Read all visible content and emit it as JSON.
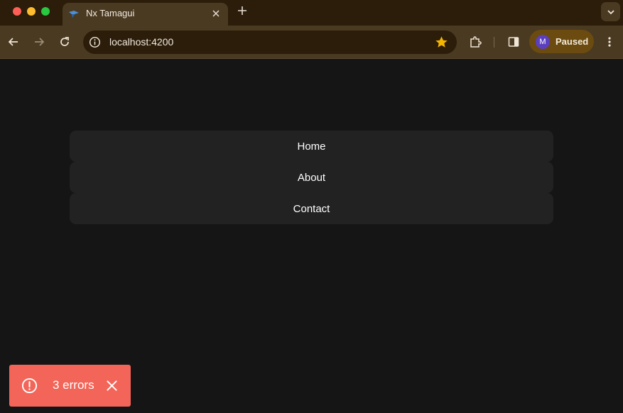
{
  "browser": {
    "tab": {
      "title": "Nx Tamagui"
    },
    "address": {
      "url": "localhost:4200"
    },
    "profile": {
      "initial": "M",
      "status": "Paused"
    }
  },
  "nav": {
    "items": [
      {
        "label": "Home"
      },
      {
        "label": "About"
      },
      {
        "label": "Contact"
      }
    ]
  },
  "toast": {
    "message": "3 errors"
  },
  "colors": {
    "tab_strip_bg": "#2b1d09",
    "toolbar_bg": "#4a3a22",
    "page_bg": "#151515",
    "nav_item_bg": "#222222",
    "toast_bg": "#f26558",
    "star": "#f5b400",
    "avatar": "#5b3fbf"
  }
}
